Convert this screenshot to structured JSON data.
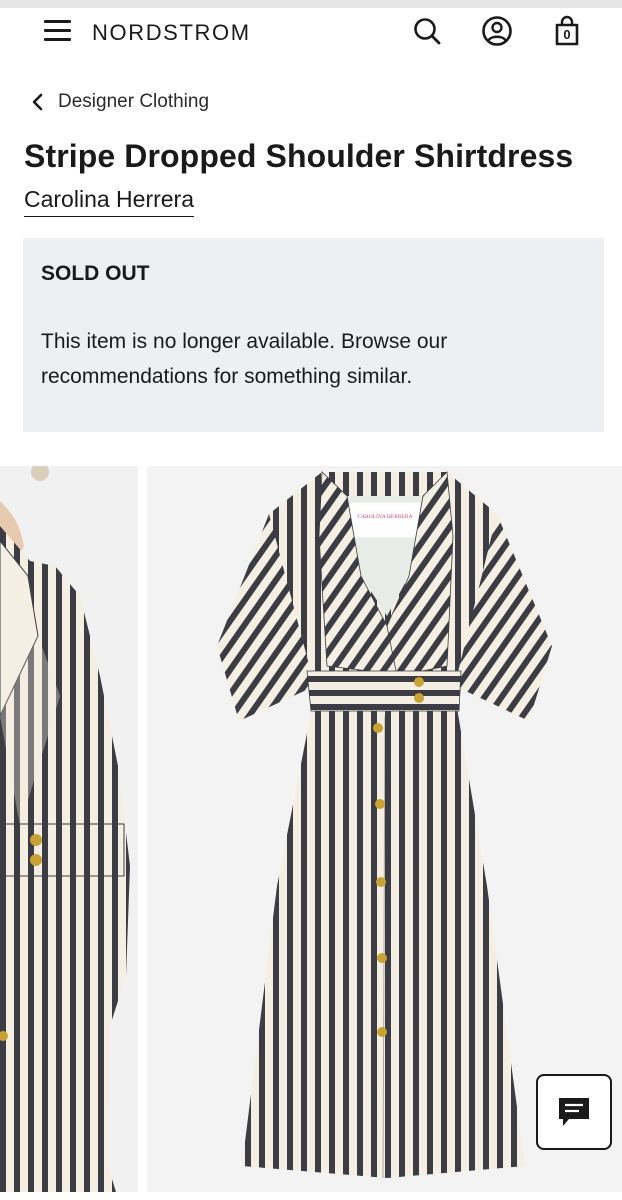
{
  "header": {
    "logo": "NORDSTROM",
    "menu_icon": "hamburger-menu-icon",
    "search_icon": "search-icon",
    "account_icon": "account-icon",
    "bag_icon": "shopping-bag-icon",
    "bag_count": "0"
  },
  "breadcrumb": {
    "icon": "chevron-left-icon",
    "label": "Designer Clothing"
  },
  "product": {
    "title": "Stripe Dropped Shoulder Shirtdress",
    "brand": "Carolina Herrera"
  },
  "notice": {
    "heading": "SOLD OUT",
    "message": "This item is no longer available. Browse our recommendations for something similar."
  },
  "gallery": {
    "dress_label_text": "CAROLINA HERRERA"
  },
  "chat": {
    "icon": "chat-icon"
  },
  "colors": {
    "notice_bg": "#edf0f3",
    "text": "#1a1a1a",
    "stripe_dark": "#3b3c44",
    "stripe_light": "#f4efe2",
    "button_gold": "#c9a233"
  }
}
